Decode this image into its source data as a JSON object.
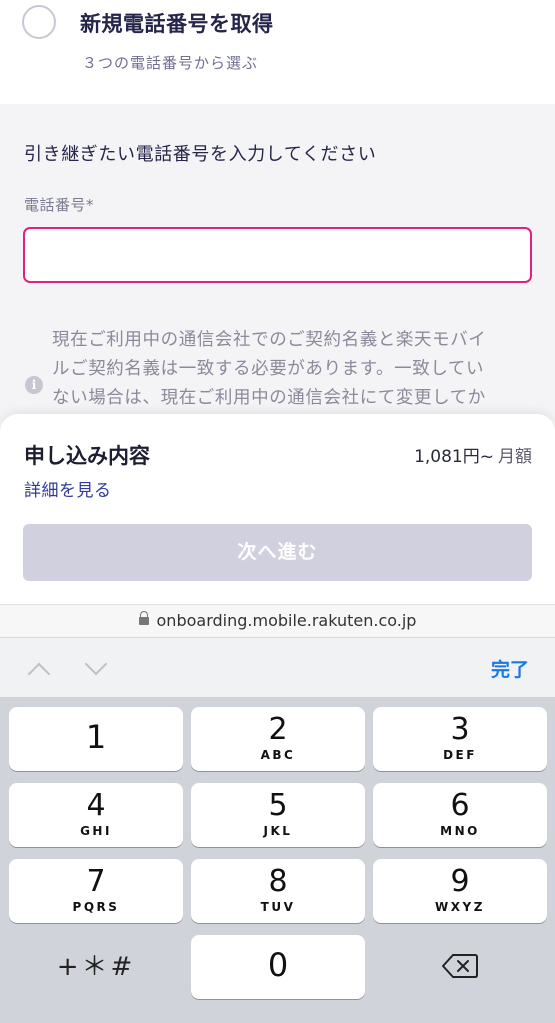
{
  "option": {
    "title": "新規電話番号を取得",
    "subtitle": "３つの電話番号から選ぶ"
  },
  "form": {
    "prompt": "引き継ぎたい電話番号を入力してください",
    "phone_label": "電話番号*",
    "phone_value": "",
    "phone_placeholder": "",
    "notice_line1": "現在ご利用中の通信会社でのご契約名義と楽天モバイ",
    "notice_line2": "ルご契約名義は一致する必要があります。一致してい",
    "notice_line3": "ない場合は、現在ご利用中の通信会社にて変更してか"
  },
  "summary": {
    "title": "申し込み内容",
    "price": "1,081円~",
    "period": "月額",
    "detail_link": "詳細を見る",
    "next_button": "次へ進む"
  },
  "browser": {
    "url": "onboarding.mobile.rakuten.co.jp"
  },
  "accessory": {
    "done": "完了"
  },
  "keypad": {
    "keys": [
      {
        "num": "1",
        "letters": ""
      },
      {
        "num": "2",
        "letters": "ABC"
      },
      {
        "num": "3",
        "letters": "DEF"
      },
      {
        "num": "4",
        "letters": "GHI"
      },
      {
        "num": "5",
        "letters": "JKL"
      },
      {
        "num": "6",
        "letters": "MNO"
      },
      {
        "num": "7",
        "letters": "PQRS"
      },
      {
        "num": "8",
        "letters": "TUV"
      },
      {
        "num": "9",
        "letters": "WXYZ"
      },
      {
        "num": "0",
        "letters": ""
      }
    ],
    "symbols": "+＊#"
  },
  "colors": {
    "input_border": "#e0217f",
    "link": "#2f3a9c",
    "done": "#1778e6",
    "disabled_button": "#d1d0de"
  }
}
